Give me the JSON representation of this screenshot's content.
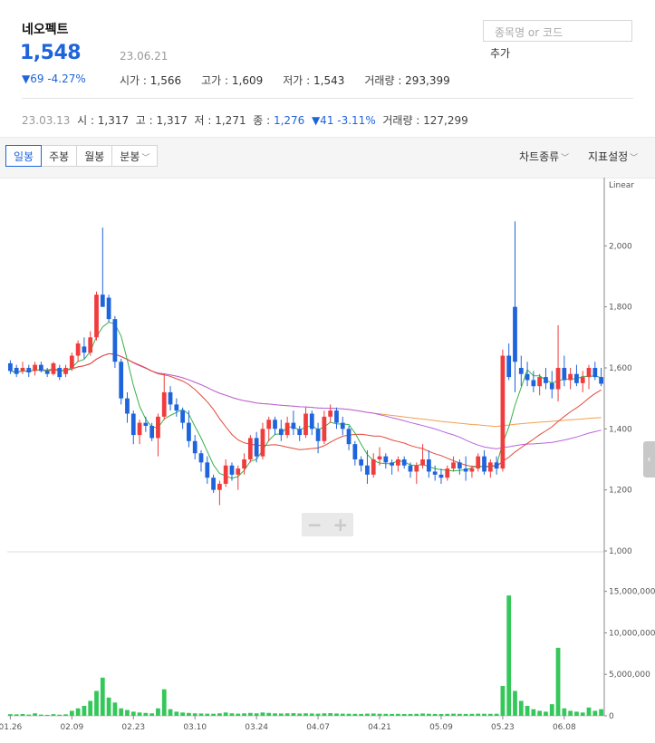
{
  "stock": {
    "name": "네오펙트",
    "price": "1,548",
    "date": "23.06.21",
    "change": "▼69 -4.27%",
    "open_label": "시가",
    "open": "1,566",
    "high_label": "고가",
    "high": "1,609",
    "low_label": "저가",
    "low": "1,543",
    "volume_label": "거래량",
    "volume": "293,399"
  },
  "search": {
    "placeholder": "종목명 or 코드",
    "add": "추가"
  },
  "prev": {
    "date": "23.03.13",
    "open_label": "시",
    "open": "1,317",
    "high_label": "고",
    "high": "1,317",
    "low_label": "저",
    "low": "1,271",
    "close_label": "종",
    "close": "1,276",
    "change": "▼41 -3.11%",
    "volume_label": "거래량",
    "volume": "127,299"
  },
  "toolbar": {
    "tabs": [
      "일봉",
      "주봉",
      "월봉",
      "분봉"
    ],
    "active_tab": 0,
    "chart_type": "차트종류",
    "indicator": "지표설정"
  },
  "colors": {
    "up": "#f03c3c",
    "down": "#1e64dc",
    "volume": "#34c759",
    "ma5": "#35b24a",
    "ma20": "#e24a3b",
    "ma60": "#b864e0",
    "ma120": "#f0a050"
  },
  "chart_data": {
    "type": "candlestick",
    "price_axis": {
      "scale": "Linear",
      "ylim": [
        1000,
        2200
      ],
      "ticks": [
        "2,000",
        "1,800",
        "1,600",
        "1,400",
        "1,200",
        "1,000"
      ]
    },
    "volume_axis": {
      "ylim": [
        0,
        19000000
      ],
      "ticks": [
        "15,000,000",
        "10,000,000",
        "5,000,000",
        "0"
      ]
    },
    "x_ticks": [
      "01.26",
      "02.09",
      "02.23",
      "03.10",
      "03.24",
      "04.07",
      "04.21",
      "05.09",
      "05.23",
      "06.08"
    ],
    "x_tick_index": [
      0,
      10,
      20,
      30,
      40,
      50,
      60,
      70,
      80,
      90
    ],
    "candles": [
      [
        1615,
        1625,
        1580,
        1590
      ],
      [
        1600,
        1610,
        1570,
        1580
      ],
      [
        1590,
        1620,
        1580,
        1600
      ],
      [
        1600,
        1610,
        1570,
        1585
      ],
      [
        1590,
        1620,
        1575,
        1610
      ],
      [
        1610,
        1620,
        1585,
        1590
      ],
      [
        1590,
        1600,
        1570,
        1580
      ],
      [
        1580,
        1620,
        1575,
        1615
      ],
      [
        1600,
        1610,
        1560,
        1570
      ],
      [
        1580,
        1610,
        1570,
        1600
      ],
      [
        1600,
        1650,
        1590,
        1640
      ],
      [
        1640,
        1690,
        1620,
        1680
      ],
      [
        1670,
        1700,
        1630,
        1650
      ],
      [
        1650,
        1720,
        1640,
        1700
      ],
      [
        1700,
        1850,
        1690,
        1840
      ],
      [
        1840,
        2060,
        1800,
        1800
      ],
      [
        1830,
        1840,
        1750,
        1760
      ],
      [
        1760,
        1770,
        1600,
        1620
      ],
      [
        1620,
        1630,
        1480,
        1500
      ],
      [
        1500,
        1520,
        1420,
        1450
      ],
      [
        1450,
        1460,
        1350,
        1380
      ],
      [
        1380,
        1430,
        1350,
        1420
      ],
      [
        1420,
        1440,
        1390,
        1410
      ],
      [
        1410,
        1420,
        1360,
        1370
      ],
      [
        1370,
        1450,
        1310,
        1440
      ],
      [
        1440,
        1580,
        1430,
        1520
      ],
      [
        1520,
        1540,
        1460,
        1480
      ],
      [
        1480,
        1500,
        1440,
        1460
      ],
      [
        1460,
        1470,
        1400,
        1420
      ],
      [
        1420,
        1460,
        1340,
        1360
      ],
      [
        1360,
        1380,
        1300,
        1320
      ],
      [
        1320,
        1330,
        1260,
        1290
      ],
      [
        1290,
        1310,
        1220,
        1240
      ],
      [
        1240,
        1250,
        1190,
        1200
      ],
      [
        1200,
        1230,
        1150,
        1220
      ],
      [
        1220,
        1300,
        1210,
        1280
      ],
      [
        1280,
        1290,
        1230,
        1250
      ],
      [
        1250,
        1280,
        1200,
        1270
      ],
      [
        1270,
        1320,
        1250,
        1300
      ],
      [
        1300,
        1380,
        1290,
        1370
      ],
      [
        1370,
        1390,
        1290,
        1310
      ],
      [
        1310,
        1420,
        1300,
        1400
      ],
      [
        1400,
        1440,
        1360,
        1430
      ],
      [
        1430,
        1440,
        1380,
        1400
      ],
      [
        1400,
        1430,
        1360,
        1380
      ],
      [
        1380,
        1440,
        1370,
        1420
      ],
      [
        1420,
        1460,
        1380,
        1400
      ],
      [
        1400,
        1410,
        1360,
        1380
      ],
      [
        1380,
        1470,
        1370,
        1450
      ],
      [
        1450,
        1460,
        1380,
        1400
      ],
      [
        1400,
        1420,
        1320,
        1360
      ],
      [
        1360,
        1460,
        1350,
        1440
      ],
      [
        1440,
        1480,
        1420,
        1460
      ],
      [
        1460,
        1470,
        1400,
        1420
      ],
      [
        1420,
        1440,
        1380,
        1400
      ],
      [
        1400,
        1410,
        1330,
        1350
      ],
      [
        1350,
        1360,
        1280,
        1300
      ],
      [
        1300,
        1310,
        1260,
        1280
      ],
      [
        1280,
        1330,
        1220,
        1250
      ],
      [
        1250,
        1320,
        1240,
        1300
      ],
      [
        1300,
        1340,
        1280,
        1310
      ],
      [
        1310,
        1320,
        1270,
        1290
      ],
      [
        1290,
        1300,
        1250,
        1280
      ],
      [
        1280,
        1310,
        1260,
        1300
      ],
      [
        1300,
        1310,
        1270,
        1280
      ],
      [
        1280,
        1290,
        1240,
        1260
      ],
      [
        1260,
        1290,
        1220,
        1280
      ],
      [
        1280,
        1350,
        1270,
        1300
      ],
      [
        1300,
        1330,
        1240,
        1260
      ],
      [
        1260,
        1280,
        1230,
        1250
      ],
      [
        1250,
        1270,
        1220,
        1240
      ],
      [
        1240,
        1280,
        1230,
        1270
      ],
      [
        1270,
        1310,
        1260,
        1290
      ],
      [
        1290,
        1300,
        1250,
        1270
      ],
      [
        1270,
        1310,
        1230,
        1260
      ],
      [
        1260,
        1280,
        1240,
        1270
      ],
      [
        1270,
        1320,
        1260,
        1310
      ],
      [
        1310,
        1330,
        1250,
        1260
      ],
      [
        1260,
        1300,
        1240,
        1290
      ],
      [
        1290,
        1310,
        1250,
        1270
      ],
      [
        1270,
        1660,
        1260,
        1640
      ],
      [
        1640,
        1680,
        1560,
        1570
      ],
      [
        1800,
        2080,
        1520,
        1620
      ],
      [
        1600,
        1640,
        1540,
        1580
      ],
      [
        1580,
        1620,
        1540,
        1560
      ],
      [
        1560,
        1590,
        1520,
        1540
      ],
      [
        1540,
        1580,
        1510,
        1570
      ],
      [
        1570,
        1600,
        1530,
        1550
      ],
      [
        1550,
        1590,
        1500,
        1530
      ],
      [
        1530,
        1740,
        1490,
        1600
      ],
      [
        1600,
        1640,
        1540,
        1560
      ],
      [
        1560,
        1600,
        1530,
        1580
      ],
      [
        1580,
        1610,
        1540,
        1550
      ],
      [
        1550,
        1590,
        1520,
        1570
      ],
      [
        1570,
        1610,
        1530,
        1600
      ],
      [
        1600,
        1620,
        1560,
        1570
      ],
      [
        1570,
        1600,
        1540,
        1548
      ]
    ],
    "volumes": [
      200000,
      180000,
      220000,
      150000,
      300000,
      150000,
      120000,
      200000,
      140000,
      180000,
      600000,
      900000,
      1200000,
      1800000,
      3000000,
      4600000,
      2200000,
      1600000,
      900000,
      700000,
      500000,
      400000,
      350000,
      300000,
      900000,
      3200000,
      800000,
      500000,
      400000,
      350000,
      300000,
      280000,
      260000,
      250000,
      300000,
      400000,
      300000,
      260000,
      300000,
      350000,
      300000,
      400000,
      350000,
      300000,
      280000,
      300000,
      320000,
      280000,
      300000,
      280000,
      260000,
      300000,
      320000,
      280000,
      260000,
      250000,
      240000,
      230000,
      260000,
      280000,
      250000,
      240000,
      230000,
      240000,
      220000,
      230000,
      240000,
      280000,
      250000,
      230000,
      220000,
      240000,
      260000,
      240000,
      230000,
      240000,
      260000,
      250000,
      240000,
      250000,
      3600000,
      14500000,
      3000000,
      1800000,
      1200000,
      800000,
      600000,
      500000,
      1400000,
      8200000,
      900000,
      600000,
      500000,
      400000,
      1000000,
      600000,
      800000
    ]
  }
}
